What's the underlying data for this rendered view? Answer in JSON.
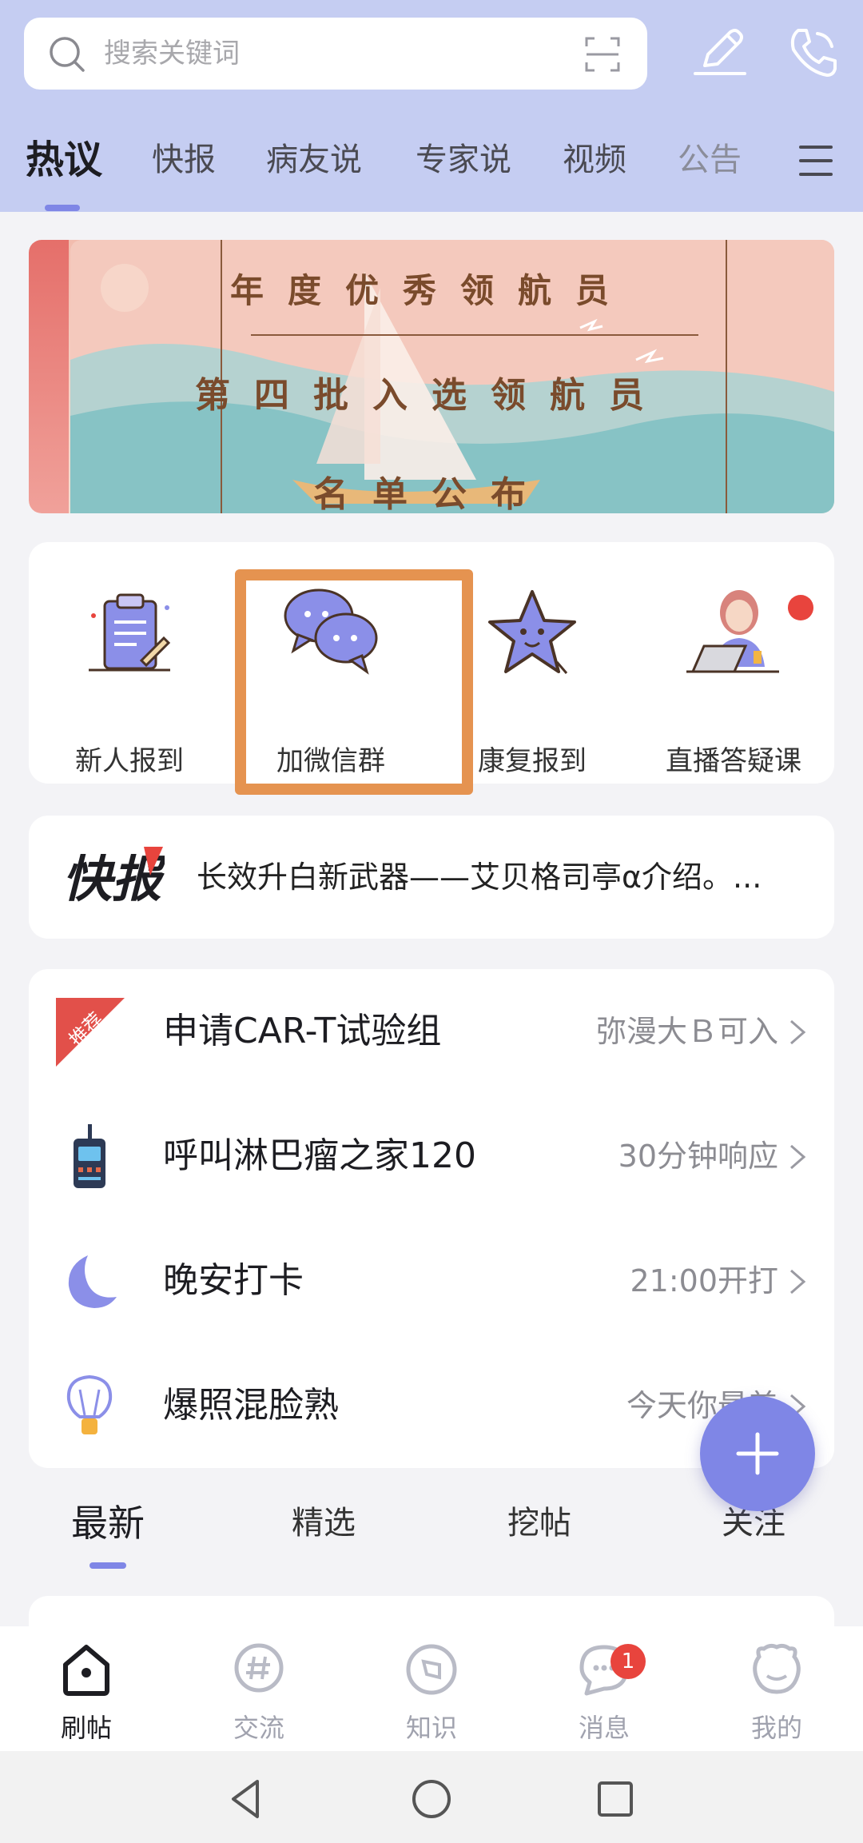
{
  "search": {
    "placeholder": "搜索关键词"
  },
  "top_tabs": [
    "热议",
    "快报",
    "病友说",
    "专家说",
    "视频",
    "公告"
  ],
  "banner": {
    "line1": "年度优秀领航员",
    "line2": "第四批入选领航员",
    "line3": "名单公布"
  },
  "quick_entries": [
    "新人报到",
    "加微信群",
    "康复报到",
    "直播答疑课"
  ],
  "news": {
    "logo_text": "快报",
    "headline": "长效升白新武器——艾贝格司亭α介绍。..."
  },
  "list": [
    {
      "title": "申请CAR-T试验组",
      "note": "弥漫大Ｂ可入",
      "badge": "推荐"
    },
    {
      "title": "呼叫淋巴瘤之家120",
      "note": "30分钟响应"
    },
    {
      "title": "晚安打卡",
      "note": "21:00开打"
    },
    {
      "title": "爆照混脸熟",
      "note": "今天你最美"
    }
  ],
  "feed_tabs": [
    "最新",
    "精选",
    "挖帖",
    "关注"
  ],
  "bottom_nav": [
    "刷帖",
    "交流",
    "知识",
    "消息",
    "我的"
  ],
  "message_badge": "1",
  "colors": {
    "accent": "#7f86e6",
    "header_bg": "#c5cdf2",
    "highlight": "#e59350",
    "badge_red": "#e8443d"
  }
}
